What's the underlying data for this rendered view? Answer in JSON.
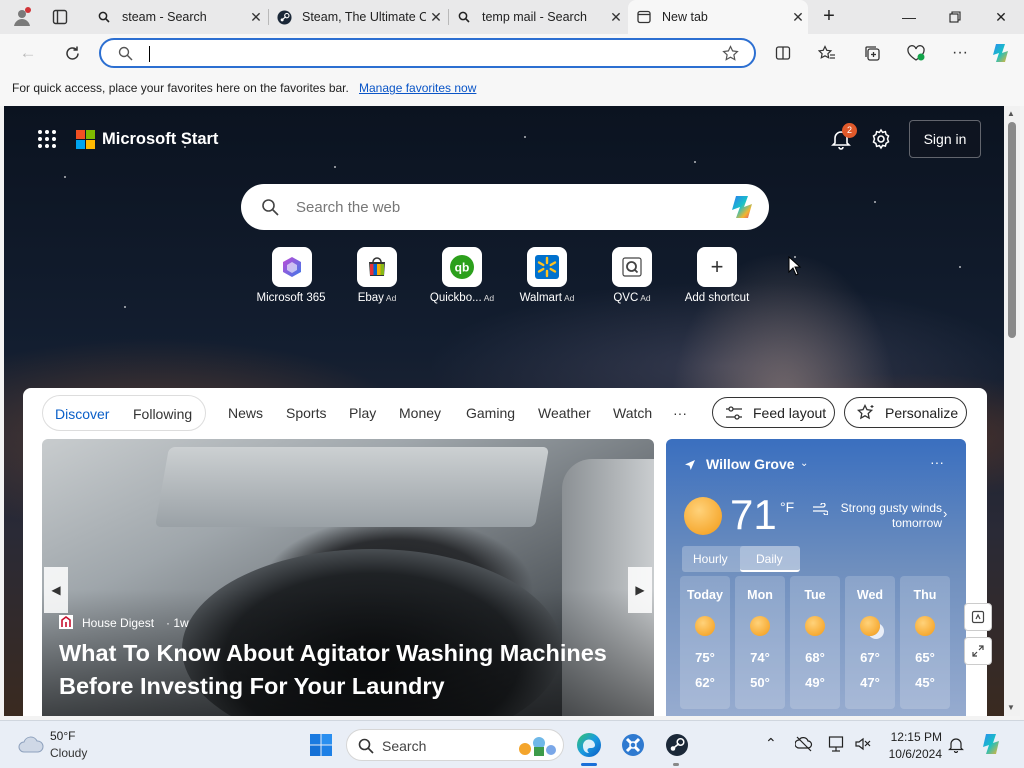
{
  "tabs": [
    {
      "title": "steam - Search",
      "icon": "search-icon"
    },
    {
      "title": "Steam, The Ultimate O",
      "icon": "steam-icon"
    },
    {
      "title": "temp mail - Search",
      "icon": "search-icon"
    },
    {
      "title": "New tab",
      "icon": "newtab-icon",
      "active": true
    }
  ],
  "address": {
    "value": ""
  },
  "favbar": {
    "text": "For quick access, place your favorites here on the favorites bar.",
    "link": "Manage favorites now"
  },
  "header": {
    "brand": "Microsoft Start",
    "notification_count": "2",
    "signin": "Sign in"
  },
  "search": {
    "placeholder": "Search the web"
  },
  "shortcuts": [
    {
      "label": "Microsoft 365",
      "ad": ""
    },
    {
      "label": "Ebay",
      "ad": "Ad"
    },
    {
      "label": "Quickbo...",
      "ad": "Ad"
    },
    {
      "label": "Walmart",
      "ad": "Ad"
    },
    {
      "label": "QVC",
      "ad": "Ad"
    },
    {
      "label": "Add shortcut",
      "ad": ""
    }
  ],
  "feed": {
    "pills": [
      "Discover",
      "Following"
    ],
    "nav": [
      "News",
      "Sports",
      "Play",
      "Money",
      "Gaming",
      "Weather",
      "Watch",
      "···"
    ],
    "feed_layout": "Feed layout",
    "personalize": "Personalize"
  },
  "hero": {
    "source": "House Digest",
    "age": "· 1w",
    "headline": "What To Know About Agitator Washing Machines Before Investing For Your Laundry"
  },
  "weather": {
    "location": "Willow Grove",
    "temp": "71",
    "unit": "°F",
    "desc": "Strong gusty winds tomorrow",
    "tabs": [
      "Hourly",
      "Daily"
    ],
    "days": [
      {
        "day": "Today",
        "hi": "75°",
        "lo": "62°"
      },
      {
        "day": "Mon",
        "hi": "74°",
        "lo": "50°"
      },
      {
        "day": "Tue",
        "hi": "68°",
        "lo": "49°"
      },
      {
        "day": "Wed",
        "hi": "67°",
        "lo": "47°"
      },
      {
        "day": "Thu",
        "hi": "65°",
        "lo": "45°"
      }
    ]
  },
  "taskbar": {
    "weather_temp": "50°F",
    "weather_cond": "Cloudy",
    "search": "Search",
    "time": "12:15 PM",
    "date": "10/6/2024"
  },
  "colors": {
    "accent": "#0a5fc8",
    "badge": "#e0592a",
    "address_border": "#2c6fd1"
  }
}
